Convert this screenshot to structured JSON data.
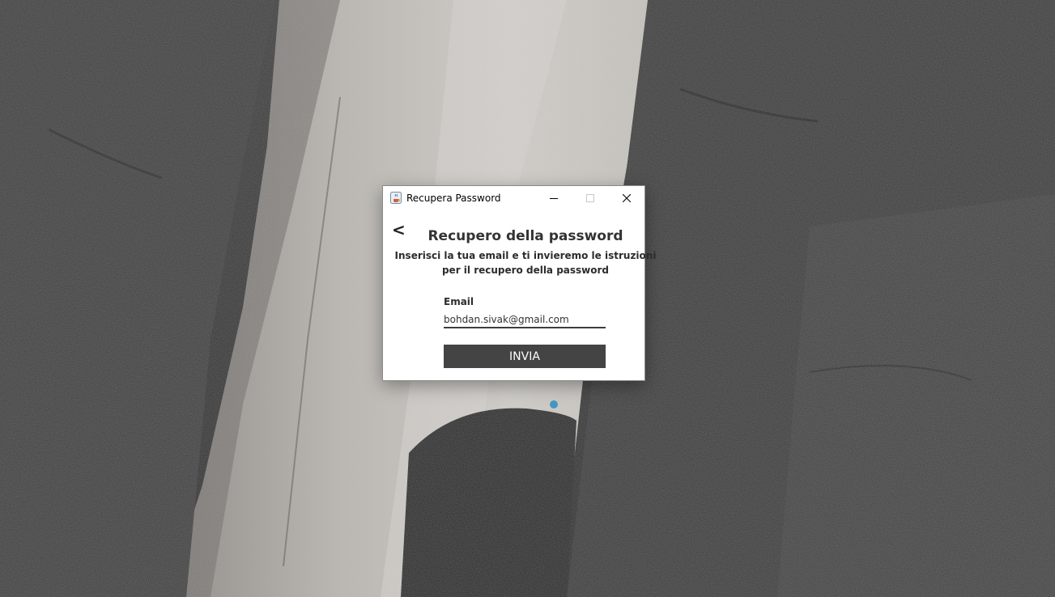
{
  "window": {
    "title": "Recupera Password",
    "app_icon": "java-cup-icon",
    "controls": {
      "minimize": "minimize-icon",
      "maximize": "maximize-icon",
      "close": "close-icon"
    }
  },
  "form": {
    "back_label": "<",
    "heading": "Recupero della password",
    "subtext_line1": "Inserisci la tua email e ti invieremo le istruzioni",
    "subtext_line2": "per il recupero della password",
    "email_label": "Email",
    "email_value": "bohdan.sivak@gmail.com",
    "submit_label": "INVIA"
  },
  "colors": {
    "button_bg": "#444444",
    "button_text": "#ffffff",
    "heading_text": "#333333"
  }
}
